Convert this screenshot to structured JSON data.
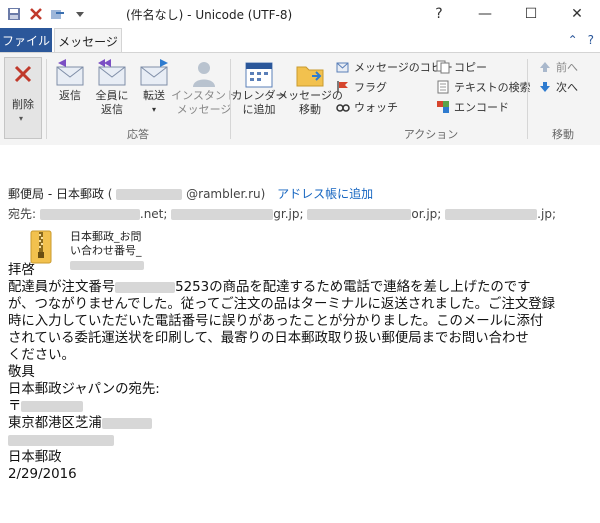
{
  "window": {
    "title": "(件名なし) - Unicode (UTF-8)",
    "controls": {
      "help": "?",
      "minimize": "—",
      "maximize": "☐",
      "close": "✕"
    }
  },
  "tabs": {
    "file": "ファイル",
    "message": "メッセージ",
    "right_up": "⌃",
    "right_help": "?"
  },
  "ribbon": {
    "delete": {
      "label": "削除"
    },
    "respond": {
      "group_label": "応答",
      "reply": "返信",
      "reply_all_1": "全員に",
      "reply_all_2": "返信",
      "forward": "転送",
      "im_1": "インスタント",
      "im_2": "メッセージ"
    },
    "calendar_1": "カレンダー",
    "calendar_2": "に追加",
    "move_1": "メッセージの",
    "move_2": "移動",
    "action": {
      "group_label": "アクション",
      "copy_message": "メッセージのコピー",
      "flag": "フラグ",
      "watch": "ウォッチ",
      "copy": "コピー",
      "find_text": "テキストの検索",
      "encode": "エンコード"
    },
    "nav": {
      "group_label": "移動",
      "prev": "前へ",
      "next": "次へ"
    },
    "colors": {
      "accent": "#2b579a",
      "ribbon_bg": "#f4f4f4"
    }
  },
  "header": {
    "from_name": "郵便局 - 日本郵政",
    "from_paren_open": "(",
    "from_address": "@rambler.ru)",
    "add_to_address_book": "アドレス帳に追加",
    "to_label": "宛先:",
    "to_parts": [
      ".net;",
      "gr.jp;",
      "or.jp;",
      ".jp;"
    ],
    "attachment_line1": "日本郵政_お問",
    "attachment_line2": "い合わせ番号_"
  },
  "body": {
    "greeting": "拝啓",
    "para1_a": "配達員が注文番号",
    "para1_b": "5253の商品を配達するため電話で連絡を差し上げたのです",
    "para1_c": "が、つながりませんでした。従ってご注文の品はターミナルに返送されました。ご注文登録",
    "para1_d": "時に入力していただいた電話番号に誤りがあったことが分かりました。このメールに添付",
    "para1_e": "されている委託運送状を印刷して、最寄りの日本郵政取り扱い郵便局までお問い合わせ",
    "para1_f": "ください。",
    "closing": "敬具",
    "dest_label": "日本郵政ジャパンの宛先:",
    "postal_mark": "〒",
    "address": "東京都港区芝浦",
    "sender": "日本郵政",
    "date": "2/29/2016"
  }
}
